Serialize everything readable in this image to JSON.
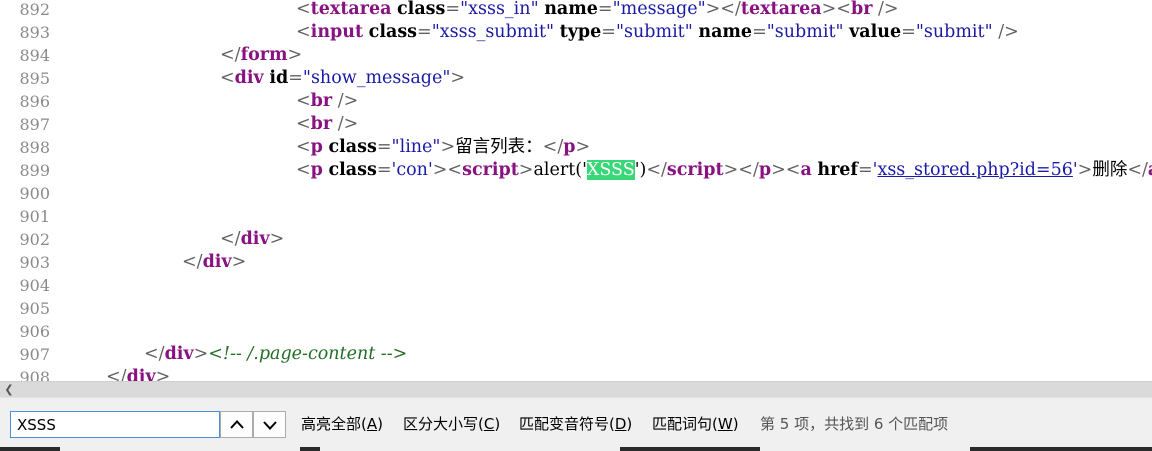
{
  "source_view": {
    "lines": [
      {
        "n": "892",
        "indent": 6,
        "segs": [
          {
            "c": "p",
            "t": "<"
          },
          {
            "c": "tag",
            "t": "textarea"
          },
          {
            "c": "txt",
            "t": " "
          },
          {
            "c": "attr",
            "t": "class"
          },
          {
            "c": "p",
            "t": "="
          },
          {
            "c": "q",
            "t": "\""
          },
          {
            "c": "val",
            "t": "xsss_in"
          },
          {
            "c": "q",
            "t": "\""
          },
          {
            "c": "txt",
            "t": " "
          },
          {
            "c": "attr",
            "t": "name"
          },
          {
            "c": "p",
            "t": "="
          },
          {
            "c": "q",
            "t": "\""
          },
          {
            "c": "val",
            "t": "message"
          },
          {
            "c": "q",
            "t": "\""
          },
          {
            "c": "p",
            "t": "></"
          },
          {
            "c": "tag",
            "t": "textarea"
          },
          {
            "c": "p",
            "t": "><"
          },
          {
            "c": "tag",
            "t": "br"
          },
          {
            "c": "p",
            "t": " />"
          }
        ]
      },
      {
        "n": "893",
        "indent": 6,
        "segs": [
          {
            "c": "p",
            "t": "<"
          },
          {
            "c": "tag",
            "t": "input"
          },
          {
            "c": "txt",
            "t": " "
          },
          {
            "c": "attr",
            "t": "class"
          },
          {
            "c": "p",
            "t": "="
          },
          {
            "c": "q",
            "t": "\""
          },
          {
            "c": "val",
            "t": "xsss_submit"
          },
          {
            "c": "q",
            "t": "\""
          },
          {
            "c": "txt",
            "t": " "
          },
          {
            "c": "attr",
            "t": "type"
          },
          {
            "c": "p",
            "t": "="
          },
          {
            "c": "q",
            "t": "\""
          },
          {
            "c": "val",
            "t": "submit"
          },
          {
            "c": "q",
            "t": "\""
          },
          {
            "c": "txt",
            "t": " "
          },
          {
            "c": "attr",
            "t": "name"
          },
          {
            "c": "p",
            "t": "="
          },
          {
            "c": "q",
            "t": "\""
          },
          {
            "c": "val",
            "t": "submit"
          },
          {
            "c": "q",
            "t": "\""
          },
          {
            "c": "txt",
            "t": " "
          },
          {
            "c": "attr",
            "t": "value"
          },
          {
            "c": "p",
            "t": "="
          },
          {
            "c": "q",
            "t": "\""
          },
          {
            "c": "val",
            "t": "submit"
          },
          {
            "c": "q",
            "t": "\""
          },
          {
            "c": "p",
            "t": " />"
          }
        ]
      },
      {
        "n": "894",
        "indent": 4,
        "segs": [
          {
            "c": "p",
            "t": "</"
          },
          {
            "c": "tag",
            "t": "form"
          },
          {
            "c": "p",
            "t": ">"
          }
        ]
      },
      {
        "n": "895",
        "indent": 4,
        "segs": [
          {
            "c": "p",
            "t": "<"
          },
          {
            "c": "tag",
            "t": "div"
          },
          {
            "c": "txt",
            "t": " "
          },
          {
            "c": "attr",
            "t": "id"
          },
          {
            "c": "p",
            "t": "="
          },
          {
            "c": "q",
            "t": "\""
          },
          {
            "c": "val",
            "t": "show_message"
          },
          {
            "c": "q",
            "t": "\""
          },
          {
            "c": "p",
            "t": ">"
          }
        ]
      },
      {
        "n": "896",
        "indent": 6,
        "segs": [
          {
            "c": "p",
            "t": "<"
          },
          {
            "c": "tag",
            "t": "br"
          },
          {
            "c": "p",
            "t": " />"
          }
        ]
      },
      {
        "n": "897",
        "indent": 6,
        "segs": [
          {
            "c": "p",
            "t": "<"
          },
          {
            "c": "tag",
            "t": "br"
          },
          {
            "c": "p",
            "t": " />"
          }
        ]
      },
      {
        "n": "898",
        "indent": 6,
        "segs": [
          {
            "c": "p",
            "t": "<"
          },
          {
            "c": "tag",
            "t": "p"
          },
          {
            "c": "txt",
            "t": " "
          },
          {
            "c": "attr",
            "t": "class"
          },
          {
            "c": "p",
            "t": "="
          },
          {
            "c": "q",
            "t": "\""
          },
          {
            "c": "val",
            "t": "line"
          },
          {
            "c": "q",
            "t": "\""
          },
          {
            "c": "p",
            "t": ">"
          },
          {
            "c": "txt",
            "t": "留言列表："
          },
          {
            "c": "p",
            "t": "</"
          },
          {
            "c": "tag",
            "t": "p"
          },
          {
            "c": "p",
            "t": ">"
          }
        ]
      },
      {
        "n": "899",
        "indent": 6,
        "segs": [
          {
            "c": "p",
            "t": "<"
          },
          {
            "c": "tag",
            "t": "p"
          },
          {
            "c": "txt",
            "t": " "
          },
          {
            "c": "attr",
            "t": "class"
          },
          {
            "c": "p",
            "t": "="
          },
          {
            "c": "q",
            "t": "'"
          },
          {
            "c": "val",
            "t": "con"
          },
          {
            "c": "q",
            "t": "'"
          },
          {
            "c": "p",
            "t": "><"
          },
          {
            "c": "tag",
            "t": "script"
          },
          {
            "c": "p",
            "t": ">"
          },
          {
            "c": "txt",
            "t": "alert('"
          },
          {
            "c": "hl",
            "t": "XSSS"
          },
          {
            "c": "txt",
            "t": "')"
          },
          {
            "c": "p",
            "t": "</"
          },
          {
            "c": "tag",
            "t": "script"
          },
          {
            "c": "p",
            "t": "></"
          },
          {
            "c": "tag",
            "t": "p"
          },
          {
            "c": "p",
            "t": "><"
          },
          {
            "c": "tag",
            "t": "a"
          },
          {
            "c": "txt",
            "t": " "
          },
          {
            "c": "attr",
            "t": "href"
          },
          {
            "c": "p",
            "t": "="
          },
          {
            "c": "q",
            "t": "'"
          },
          {
            "c": "link",
            "t": "xss_stored.php?id=56"
          },
          {
            "c": "q",
            "t": "'"
          },
          {
            "c": "p",
            "t": ">"
          },
          {
            "c": "txt",
            "t": "删除"
          },
          {
            "c": "p",
            "t": "</"
          },
          {
            "c": "tag",
            "t": "a"
          },
          {
            "c": "p",
            "t": ">"
          }
        ]
      },
      {
        "n": "900",
        "indent": 0,
        "segs": []
      },
      {
        "n": "901",
        "indent": 0,
        "segs": []
      },
      {
        "n": "902",
        "indent": 4,
        "segs": [
          {
            "c": "p",
            "t": "</"
          },
          {
            "c": "tag",
            "t": "div"
          },
          {
            "c": "p",
            "t": ">"
          }
        ]
      },
      {
        "n": "903",
        "indent": 3,
        "segs": [
          {
            "c": "p",
            "t": "</"
          },
          {
            "c": "tag",
            "t": "div"
          },
          {
            "c": "p",
            "t": ">"
          }
        ]
      },
      {
        "n": "904",
        "indent": 0,
        "segs": []
      },
      {
        "n": "905",
        "indent": 0,
        "segs": []
      },
      {
        "n": "906",
        "indent": 0,
        "segs": []
      },
      {
        "n": "907",
        "indent": 2,
        "segs": [
          {
            "c": "p",
            "t": "</"
          },
          {
            "c": "tag",
            "t": "div"
          },
          {
            "c": "p",
            "t": ">"
          },
          {
            "c": "cmt",
            "t": "<!-- /.page-content -->"
          }
        ]
      },
      {
        "n": "908",
        "indent": 1,
        "segs": [
          {
            "c": "p",
            "t": "</"
          },
          {
            "c": "tag",
            "t": "div"
          },
          {
            "c": "p",
            "t": ">"
          }
        ]
      }
    ]
  },
  "find_bar": {
    "query": "XSSS",
    "highlight_all": {
      "label": "高亮全部(",
      "key": "A",
      "close": ")"
    },
    "match_case": {
      "label": "区分大小写(",
      "key": "C",
      "close": ")"
    },
    "match_diacritics": {
      "label": "匹配变音符号(",
      "key": "D",
      "close": ")"
    },
    "whole_words": {
      "label": "匹配词句(",
      "key": "W",
      "close": ")"
    },
    "status": "第 5 项，共找到 6 个匹配项"
  }
}
